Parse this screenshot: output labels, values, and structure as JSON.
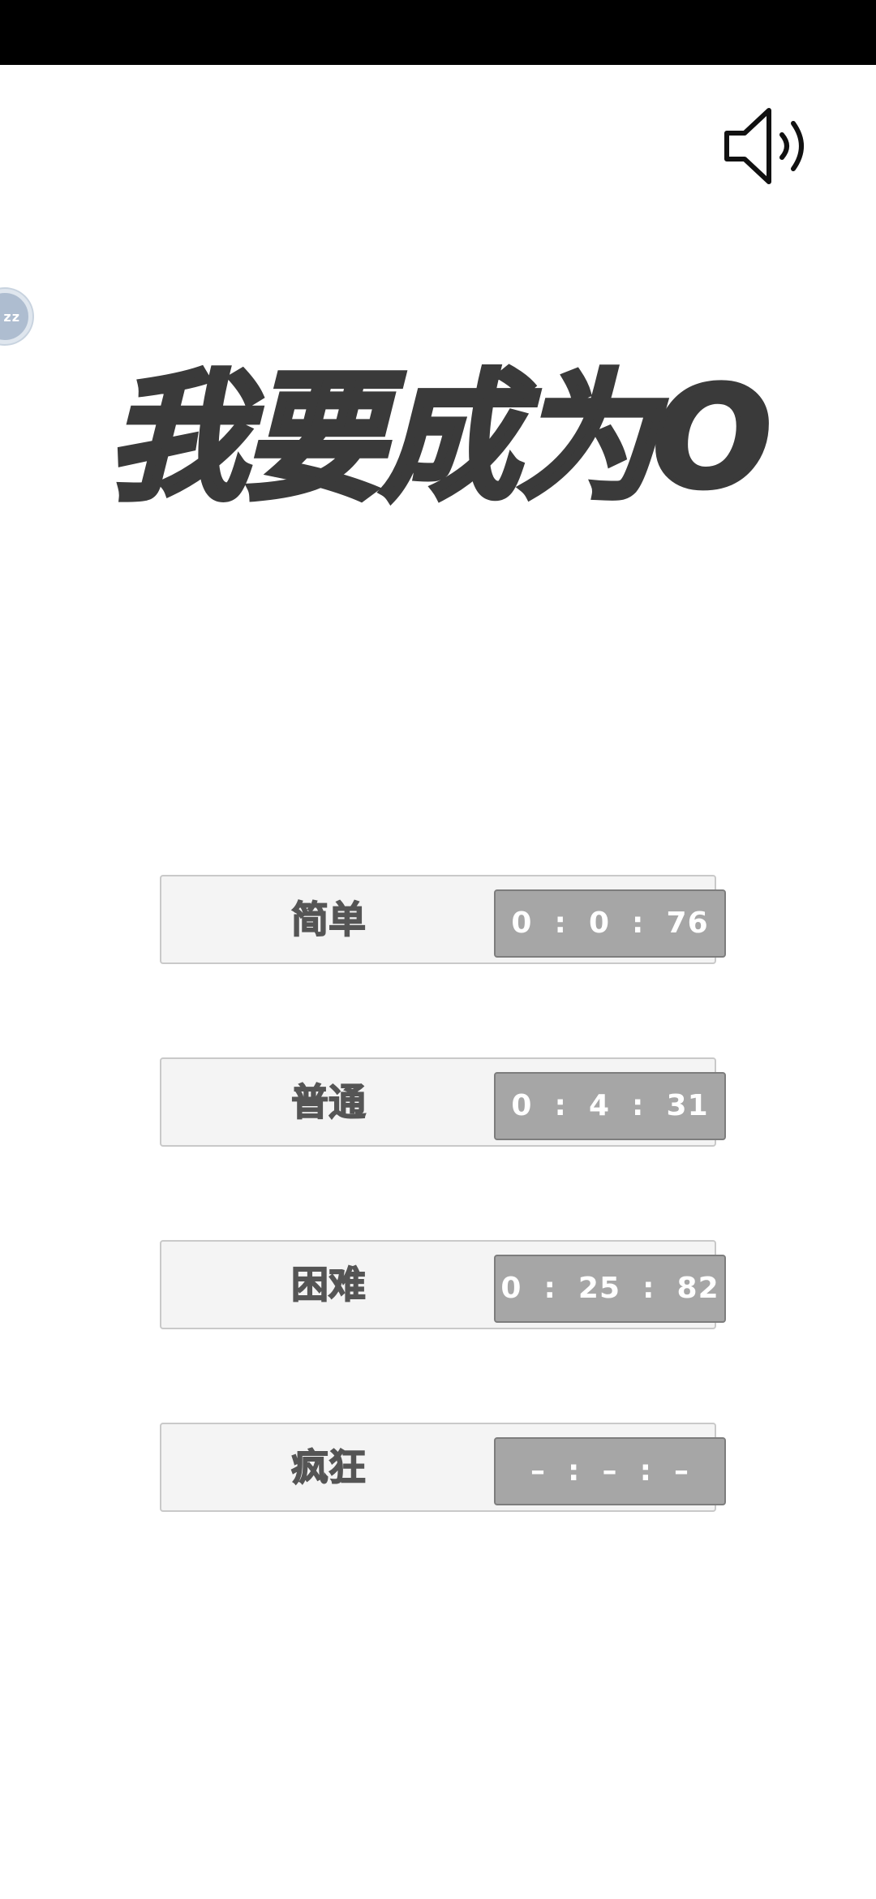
{
  "title": "我要成为O",
  "sound_icon": "speaker-volume-icon",
  "bubble_text": "zz",
  "levels": [
    {
      "label": "简单",
      "time": "0  :  0  :  76"
    },
    {
      "label": "普通",
      "time": "0  :  4  :  31"
    },
    {
      "label": "困难",
      "time": "0  :  25  :  82"
    },
    {
      "label": "疯狂",
      "time": "–  :  –  :  –"
    }
  ],
  "colors": {
    "title": "#3a3a3a",
    "row_bg": "#f4f4f4",
    "time_bg": "#a6a6a6",
    "label": "#555555"
  }
}
